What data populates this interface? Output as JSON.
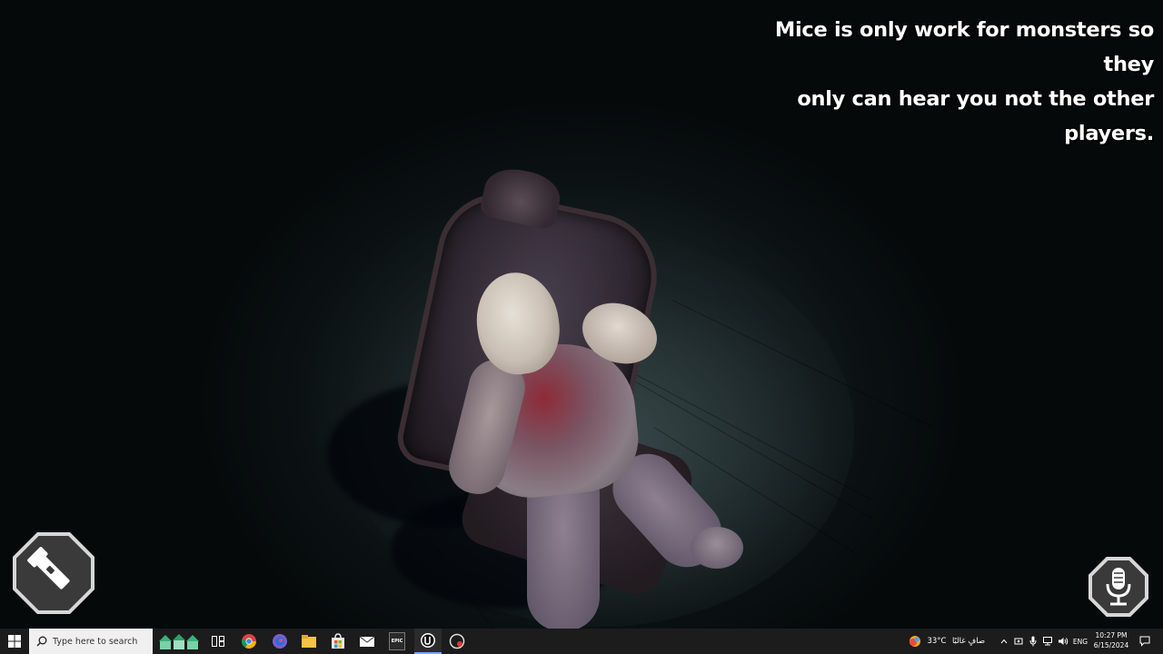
{
  "game": {
    "hint_line1": "Mice is only work for monsters so they",
    "hint_line2": "only can hear you not the other players.",
    "flashlight_icon": "flashlight-icon",
    "microphone_icon": "microphone-icon"
  },
  "taskbar": {
    "start_icon": "windows-start-icon",
    "search_placeholder": "Type here to search",
    "apps": [
      "task-view-icon",
      "chrome-icon",
      "app-icon",
      "file-explorer-icon",
      "microsoft-store-icon",
      "mail-icon",
      "epic-games-icon",
      "unreal-engine-icon",
      "recording-app-icon"
    ],
    "epic_label": "EPIC",
    "weather_temp": "33°C",
    "weather_desc": "صافٍ غالبًا",
    "language": "ENG",
    "time": "10:27 PM",
    "date": "6/15/2024"
  },
  "colors": {
    "taskbar_bg": "#1c1c1c",
    "hint_text": "#ffffff",
    "hud_badge_border": "#d7d7d7",
    "hud_badge_fill": "#3a3a3a"
  }
}
